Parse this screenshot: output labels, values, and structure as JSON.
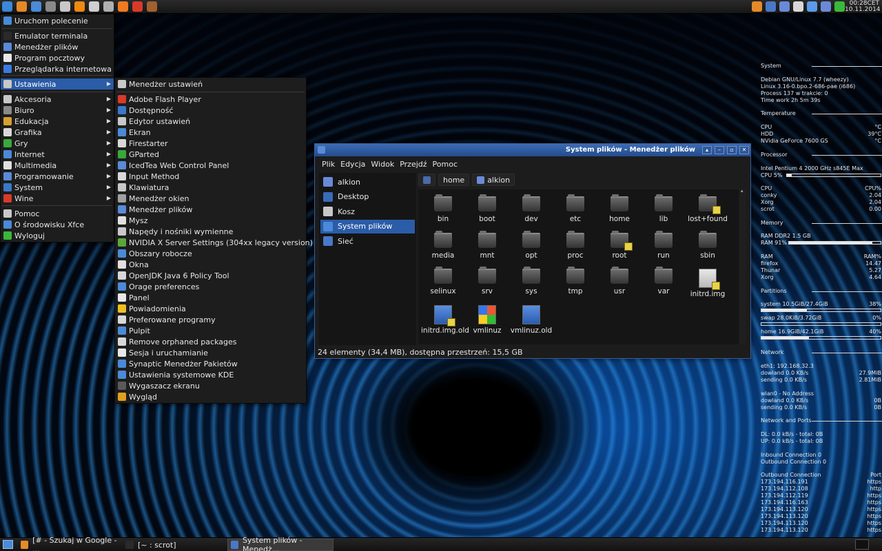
{
  "top_panel": {
    "launchers": [
      {
        "icon": "xfce-mouse-icon",
        "color": "#3a88d8"
      },
      {
        "icon": "firefox-icon",
        "color": "#e58a2a"
      },
      {
        "icon": "browser-icon",
        "color": "#4a8ad8"
      },
      {
        "icon": "steam-icon",
        "color": "#8a8a8a"
      },
      {
        "icon": "archive-icon",
        "color": "#c8c8c8"
      },
      {
        "icon": "vlc-icon",
        "color": "#f08a10"
      },
      {
        "icon": "inkscape-icon",
        "color": "#cfcfcf"
      },
      {
        "icon": "wine-icon",
        "color": "#b0b0b0"
      },
      {
        "icon": "blender-icon",
        "color": "#f07a20"
      },
      {
        "icon": "warning-icon",
        "color": "#d83a2a"
      },
      {
        "icon": "game-icon",
        "color": "#a06030"
      }
    ],
    "tray": [
      {
        "icon": "firefox-tray-icon",
        "color": "#e58a2a"
      },
      {
        "icon": "mail-tray-icon",
        "color": "#4a78c8"
      },
      {
        "icon": "drive-tray-icon",
        "color": "#6a8ad8"
      },
      {
        "icon": "notes-tray-icon",
        "color": "#d8d8d8"
      },
      {
        "icon": "settings-tray-icon",
        "color": "#5a9ae8"
      },
      {
        "icon": "network-tray-icon",
        "color": "#6a8ad8"
      },
      {
        "icon": "update-tray-icon",
        "color": "#3ab83a"
      }
    ],
    "clock": {
      "time": "00:28CET",
      "date": "10.11.2014"
    }
  },
  "main_menu": {
    "run_command": "Uruchom polecenie",
    "favorites": [
      "Emulator terminala",
      "Menedżer plików",
      "Program pocztowy",
      "Przeglądarka internetowa"
    ],
    "settings": "Ustawienia",
    "categories": [
      "Akcesoria",
      "Biuro",
      "Edukacja",
      "Grafika",
      "Gry",
      "Internet",
      "Multimedia",
      "Programowanie",
      "System",
      "Wine"
    ],
    "bottom": [
      "Pomoc",
      "O środowisku Xfce",
      "Wyloguj"
    ]
  },
  "settings_menu": {
    "header": "Menedżer ustawień",
    "items": [
      "Adobe Flash Player",
      "Dostępność",
      "Edytor ustawień",
      "Ekran",
      "Firestarter",
      "GParted",
      "IcedTea Web Control Panel",
      "Input Method",
      "Klawiatura",
      "Menedżer okien",
      "Menedżer plików",
      "Mysz",
      "Napędy i nośniki wymienne",
      "NVIDIA X Server Settings (304xx legacy version)",
      "Obszary robocze",
      "Okna",
      "OpenJDK Java 6 Policy Tool",
      "Orage preferences",
      "Panel",
      "Powiadomienia",
      "Preferowane programy",
      "Pulpit",
      "Remove orphaned packages",
      "Sesja i uruchamianie",
      "Synaptic Menedżer Pakietów",
      "Ustawienia systemowe KDE",
      "Wygaszacz ekranu",
      "Wygląd"
    ]
  },
  "file_manager": {
    "title": "System plików - Menedżer plików",
    "menubar": [
      "Plik",
      "Edycja",
      "Widok",
      "Przejdź",
      "Pomoc"
    ],
    "sidebar": [
      "alkion",
      "Desktop",
      "Kosz",
      "System plików",
      "Sieć"
    ],
    "path": [
      "home",
      "alkion"
    ],
    "files": [
      {
        "name": "bin",
        "kind": "folder"
      },
      {
        "name": "boot",
        "kind": "folder"
      },
      {
        "name": "dev",
        "kind": "folder"
      },
      {
        "name": "etc",
        "kind": "folder"
      },
      {
        "name": "home",
        "kind": "folder"
      },
      {
        "name": "lib",
        "kind": "folder"
      },
      {
        "name": "lost+found",
        "kind": "folder-locked"
      },
      {
        "name": "media",
        "kind": "folder"
      },
      {
        "name": "mnt",
        "kind": "folder"
      },
      {
        "name": "opt",
        "kind": "folder"
      },
      {
        "name": "proc",
        "kind": "folder"
      },
      {
        "name": "root",
        "kind": "folder-locked"
      },
      {
        "name": "run",
        "kind": "folder"
      },
      {
        "name": "sbin",
        "kind": "folder"
      },
      {
        "name": "selinux",
        "kind": "folder"
      },
      {
        "name": "srv",
        "kind": "folder"
      },
      {
        "name": "sys",
        "kind": "folder"
      },
      {
        "name": "tmp",
        "kind": "folder"
      },
      {
        "name": "usr",
        "kind": "folder"
      },
      {
        "name": "var",
        "kind": "folder"
      },
      {
        "name": "initrd.img",
        "kind": "file-locked"
      },
      {
        "name": "initrd.img.old",
        "kind": "blue-locked"
      },
      {
        "name": "vmlinuz",
        "kind": "win"
      },
      {
        "name": "vmlinuz.old",
        "kind": "blue"
      }
    ],
    "status": "24 elementy (34,4 MB), dostępna przestrzeń: 15,5 GB"
  },
  "conky": {
    "system_head": "System",
    "system_lines": [
      "Debian GNU/Linux 7.7 (wheezy)",
      "Linux 3.16-0.bpo.2-686-pae (i686)",
      "Process 137 w trakcie: 0",
      "Time work 2h 5m 39s"
    ],
    "temp_head": "Temperature",
    "temps": [
      [
        "CPU",
        "°C"
      ],
      [
        "HDD",
        "39°C"
      ],
      [
        "NVidia GeForce 7600 GS",
        "°C"
      ]
    ],
    "proc_head": "Processor",
    "cpu_name": "Intel Pentium 4 2000 GHz s845E Max",
    "cpu_usage": {
      "label": "CPU 5%",
      "value": 0.05
    },
    "cpu_procs": [
      [
        "CPU",
        "CPU%"
      ],
      [
        "conky",
        "2.04"
      ],
      [
        "Xorg",
        "2.04"
      ],
      [
        "scrot",
        "0.00"
      ]
    ],
    "mem_head": "Memory",
    "ram_label": "RAM DDR2 1.5 GB",
    "ram_usage": {
      "label": "RAM 91%",
      "value": 0.91
    },
    "ram_procs": [
      [
        "RAM",
        "RAM%"
      ],
      [
        "firefox",
        "14.47"
      ],
      [
        "Thunar",
        "5.27"
      ],
      [
        "Xorg",
        "4.64"
      ]
    ],
    "part_head": "Partitions",
    "partitions": [
      {
        "left": "system 10.5GiB/27.4GiB",
        "right": "38%",
        "value": 0.38
      },
      {
        "left": "swap 28.0KiB/3.72GiB",
        "right": "0%",
        "value": 0.0
      },
      {
        "left": "home 16.9GiB/42.1GiB",
        "right": "40%",
        "value": 0.4
      }
    ],
    "net_head": "Network",
    "net_lines": [
      [
        "eth1:  192.168.32.3",
        ""
      ],
      [
        "dowland  0.0 KB/s",
        "27.9MiB"
      ],
      [
        "sending  0.0 KB/s",
        "2.81MiB"
      ],
      [
        "",
        ""
      ],
      [
        "wlan0 - No Address",
        ""
      ],
      [
        "dowland  0.0 KB/s",
        "0B"
      ],
      [
        "sending  0.0 KB/s",
        "0B"
      ]
    ],
    "ports_head": "Network and Ports",
    "ports_lines": [
      "DL: 0.0 kB/s - total: 0B",
      "UP: 0.0 kB/s - total: 0B",
      "",
      "Inbound Connection 0",
      "Outbound Connection 0",
      ""
    ],
    "outbound_head": [
      "Outbound Connection",
      "Port"
    ],
    "outbound": [
      [
        "173.194.116.191",
        "https"
      ],
      [
        "173.194.112.108",
        "http"
      ],
      [
        "173.194.112.119",
        "https"
      ],
      [
        "173.194.116.163",
        "https"
      ],
      [
        "173.194.113.120",
        "https"
      ],
      [
        "173.194.113.120",
        "https"
      ],
      [
        "173.194.113.120",
        "https"
      ],
      [
        "173.194.113.120",
        "https"
      ]
    ]
  },
  "taskbar": {
    "tasks": [
      {
        "label": "[# - Szukaj w Google - ...",
        "icon": "firefox-task-icon",
        "color": "#e58a2a"
      },
      {
        "label": "[~ : scrot]",
        "icon": "terminal-task-icon",
        "color": "#2a2a2a"
      },
      {
        "label": "System plików - Menedż...",
        "icon": "filemanager-task-icon",
        "color": "#4a78c8"
      }
    ],
    "menu_button_color": "#4a8ad8"
  }
}
